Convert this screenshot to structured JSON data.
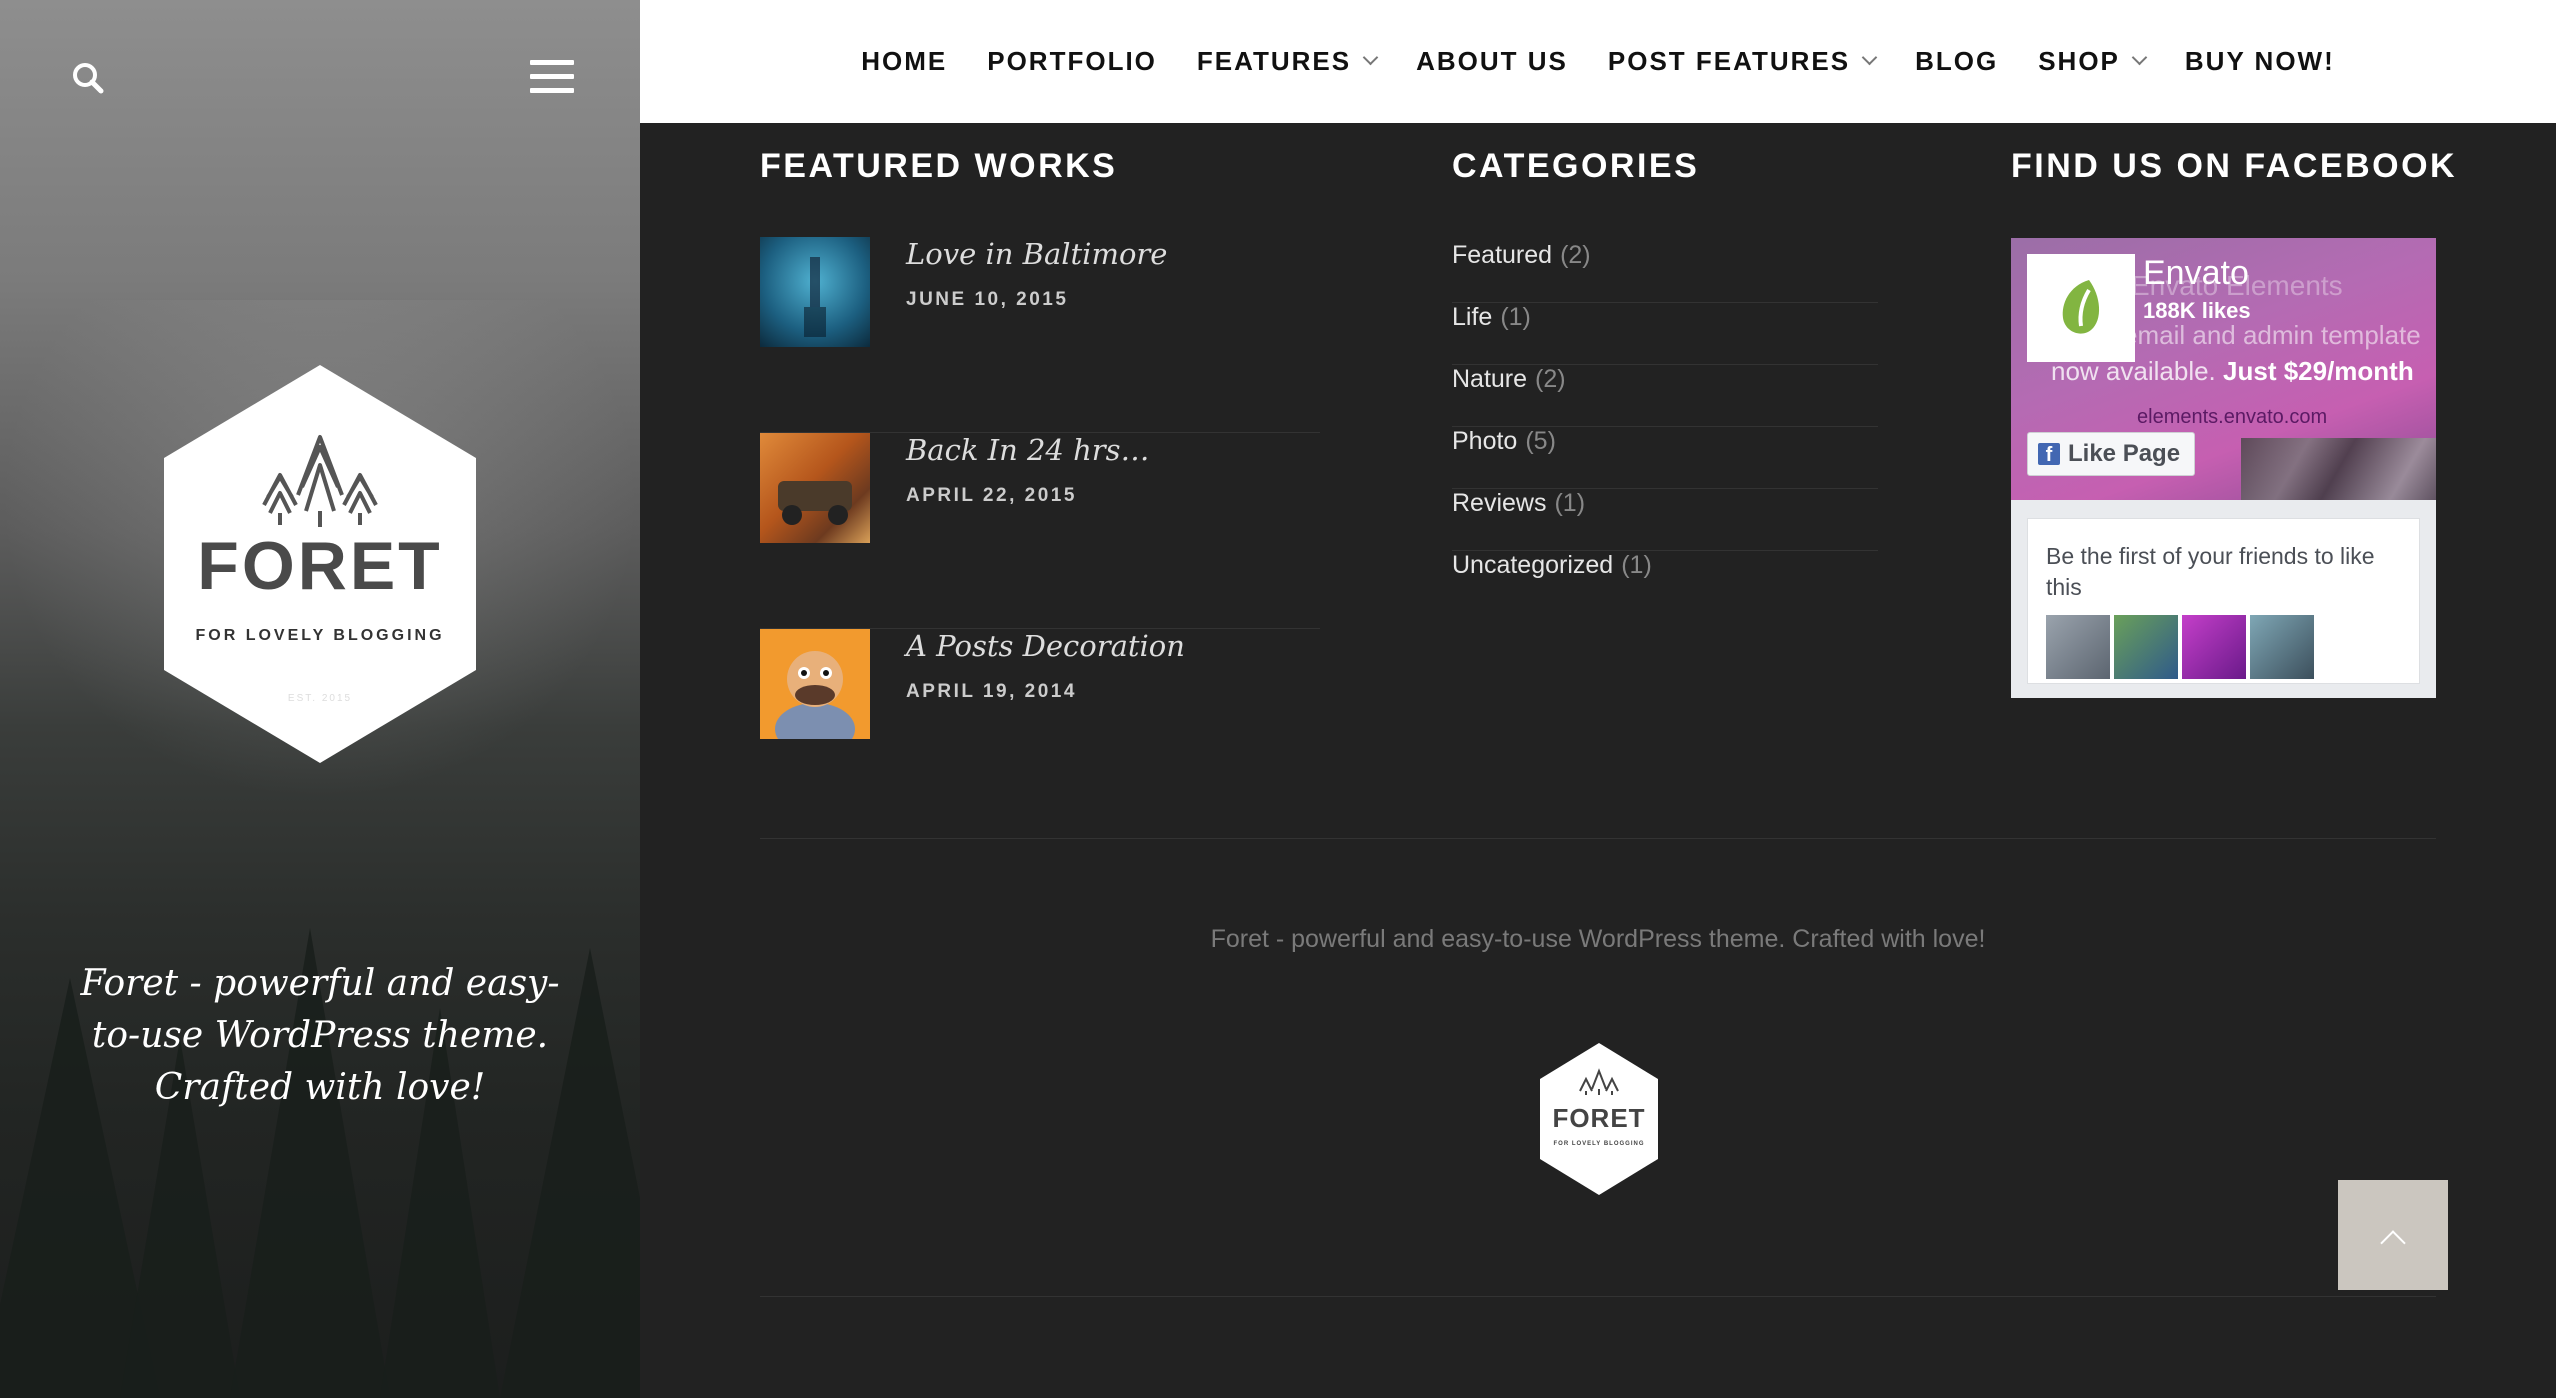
{
  "sidebar": {
    "logo": {
      "name": "FORET",
      "tagline": "FOR LOVELY BLOGGING",
      "est": "EST. 2015"
    },
    "description": "Foret - powerful and easy-to-use WordPress theme. Crafted with love!"
  },
  "nav": {
    "items": [
      {
        "label": "HOME",
        "dropdown": false
      },
      {
        "label": "PORTFOLIO",
        "dropdown": false
      },
      {
        "label": "FEATURES",
        "dropdown": true
      },
      {
        "label": "ABOUT US",
        "dropdown": false
      },
      {
        "label": "POST FEATURES",
        "dropdown": true
      },
      {
        "label": "BLOG",
        "dropdown": false
      },
      {
        "label": "SHOP",
        "dropdown": true
      },
      {
        "label": "BUY NOW!",
        "dropdown": false
      }
    ]
  },
  "featured": {
    "title": "FEATURED WORKS",
    "items": [
      {
        "title": "Love in Baltimore",
        "date": "JUNE 10, 2015"
      },
      {
        "title": "Back In 24 hrs…",
        "date": "APRIL 22, 2015"
      },
      {
        "title": "A Posts Decoration",
        "date": "APRIL 19, 2014"
      }
    ]
  },
  "categories": {
    "title": "CATEGORIES",
    "items": [
      {
        "name": "Featured",
        "count": "(2)"
      },
      {
        "name": "Life",
        "count": "(1)"
      },
      {
        "name": "Nature",
        "count": "(2)"
      },
      {
        "name": "Photo",
        "count": "(5)"
      },
      {
        "name": "Reviews",
        "count": "(1)"
      },
      {
        "name": "Uncategorized",
        "count": "(1)"
      }
    ]
  },
  "facebook": {
    "title": "FIND US ON FACEBOOK",
    "page_name": "Envato",
    "likes": "188K likes",
    "cover_line1": "Envato Elements",
    "cover_line2": "email and admin template",
    "cover_line3_prefix": "now available.",
    "cover_line3_price": "Just $29/month",
    "cover_url": "elements.envato.com",
    "like_button": "Like Page",
    "friends_text": "Be the first of your friends to like this"
  },
  "footer": {
    "text": "Foret - powerful and easy-to-use WordPress theme. Crafted with love!",
    "logo_name": "FORET",
    "logo_tagline": "FOR LOVELY BLOGGING"
  },
  "colors": {
    "accent_totop": "#cbc6bf",
    "main_bg": "#222222",
    "nav_bg": "#ffffff",
    "envato_green": "#82b541"
  }
}
